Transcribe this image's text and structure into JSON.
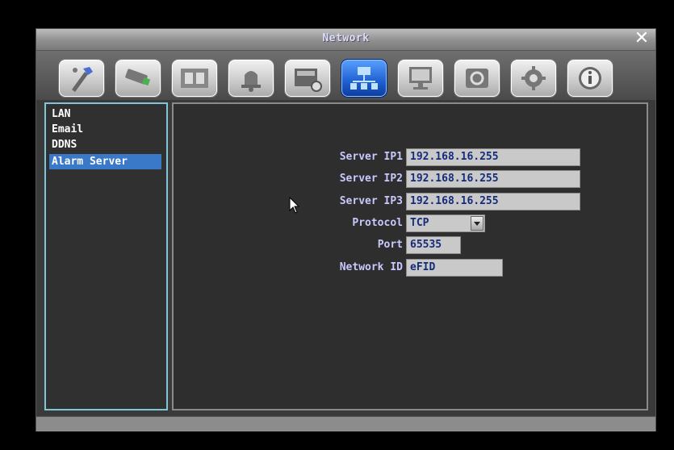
{
  "window": {
    "title": "Network"
  },
  "toolbar": {
    "icons": [
      "quick-setup-icon",
      "camera-icon",
      "film-icon",
      "alarm-bell-icon",
      "record-schedule-icon",
      "network-icon",
      "display-icon",
      "backup-icon",
      "settings-gear-icon",
      "info-icon"
    ],
    "active_icon": "network-icon"
  },
  "sidebar": {
    "items": [
      {
        "label": "LAN"
      },
      {
        "label": "Email"
      },
      {
        "label": "DDNS"
      },
      {
        "label": "Alarm Server"
      }
    ],
    "selected": "Alarm Server"
  },
  "form": {
    "server_ip1": {
      "label": "Server IP1",
      "value": "192.168.16.255"
    },
    "server_ip2": {
      "label": "Server IP2",
      "value": "192.168.16.255"
    },
    "server_ip3": {
      "label": "Server IP3",
      "value": "192.168.16.255"
    },
    "protocol": {
      "label": "Protocol",
      "value": "TCP"
    },
    "port": {
      "label": "Port",
      "value": "65535"
    },
    "network_id": {
      "label": "Network ID",
      "value": "eFID"
    }
  },
  "colors": {
    "accent_selected": "#3a78c8",
    "active_tool": "#1e5fd0",
    "label_text": "#c9c9ff",
    "field_text": "#142b7a",
    "sidebar_border": "#7fc6d8"
  }
}
